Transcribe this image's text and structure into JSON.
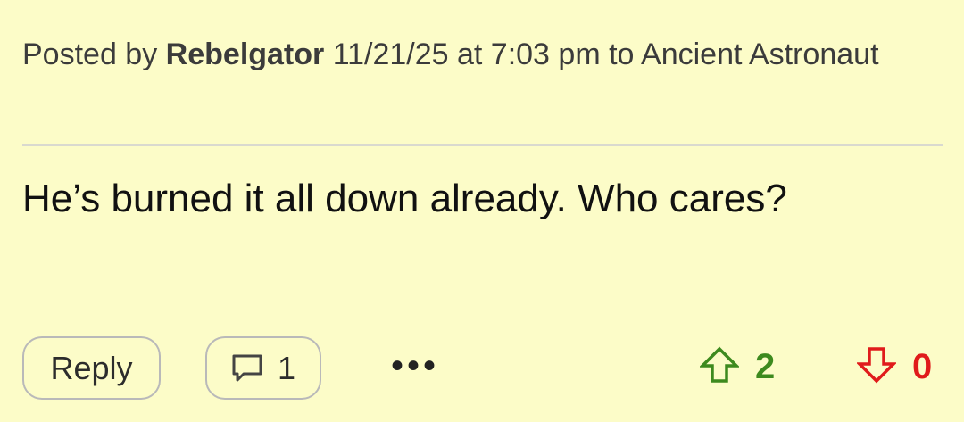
{
  "post": {
    "posted_by_prefix": "Posted by",
    "author": "Rebelgator",
    "timestamp_suffix": "11/21/25 at 7:03 pm to Ancient Astronaut",
    "body": "He’s burned it all down already. Who cares?"
  },
  "actions": {
    "reply_label": "Reply",
    "comment_count": "1",
    "more_label": "•••",
    "upvote_count": "2",
    "downvote_count": "0",
    "upvote_icon": "arrow-up-outline-icon",
    "downvote_icon": "arrow-down-outline-icon",
    "comment_icon": "speech-bubble-icon"
  },
  "colors": {
    "background": "#fcfcc8",
    "upvote": "#3d8a1e",
    "downvote": "#e01b1b"
  }
}
